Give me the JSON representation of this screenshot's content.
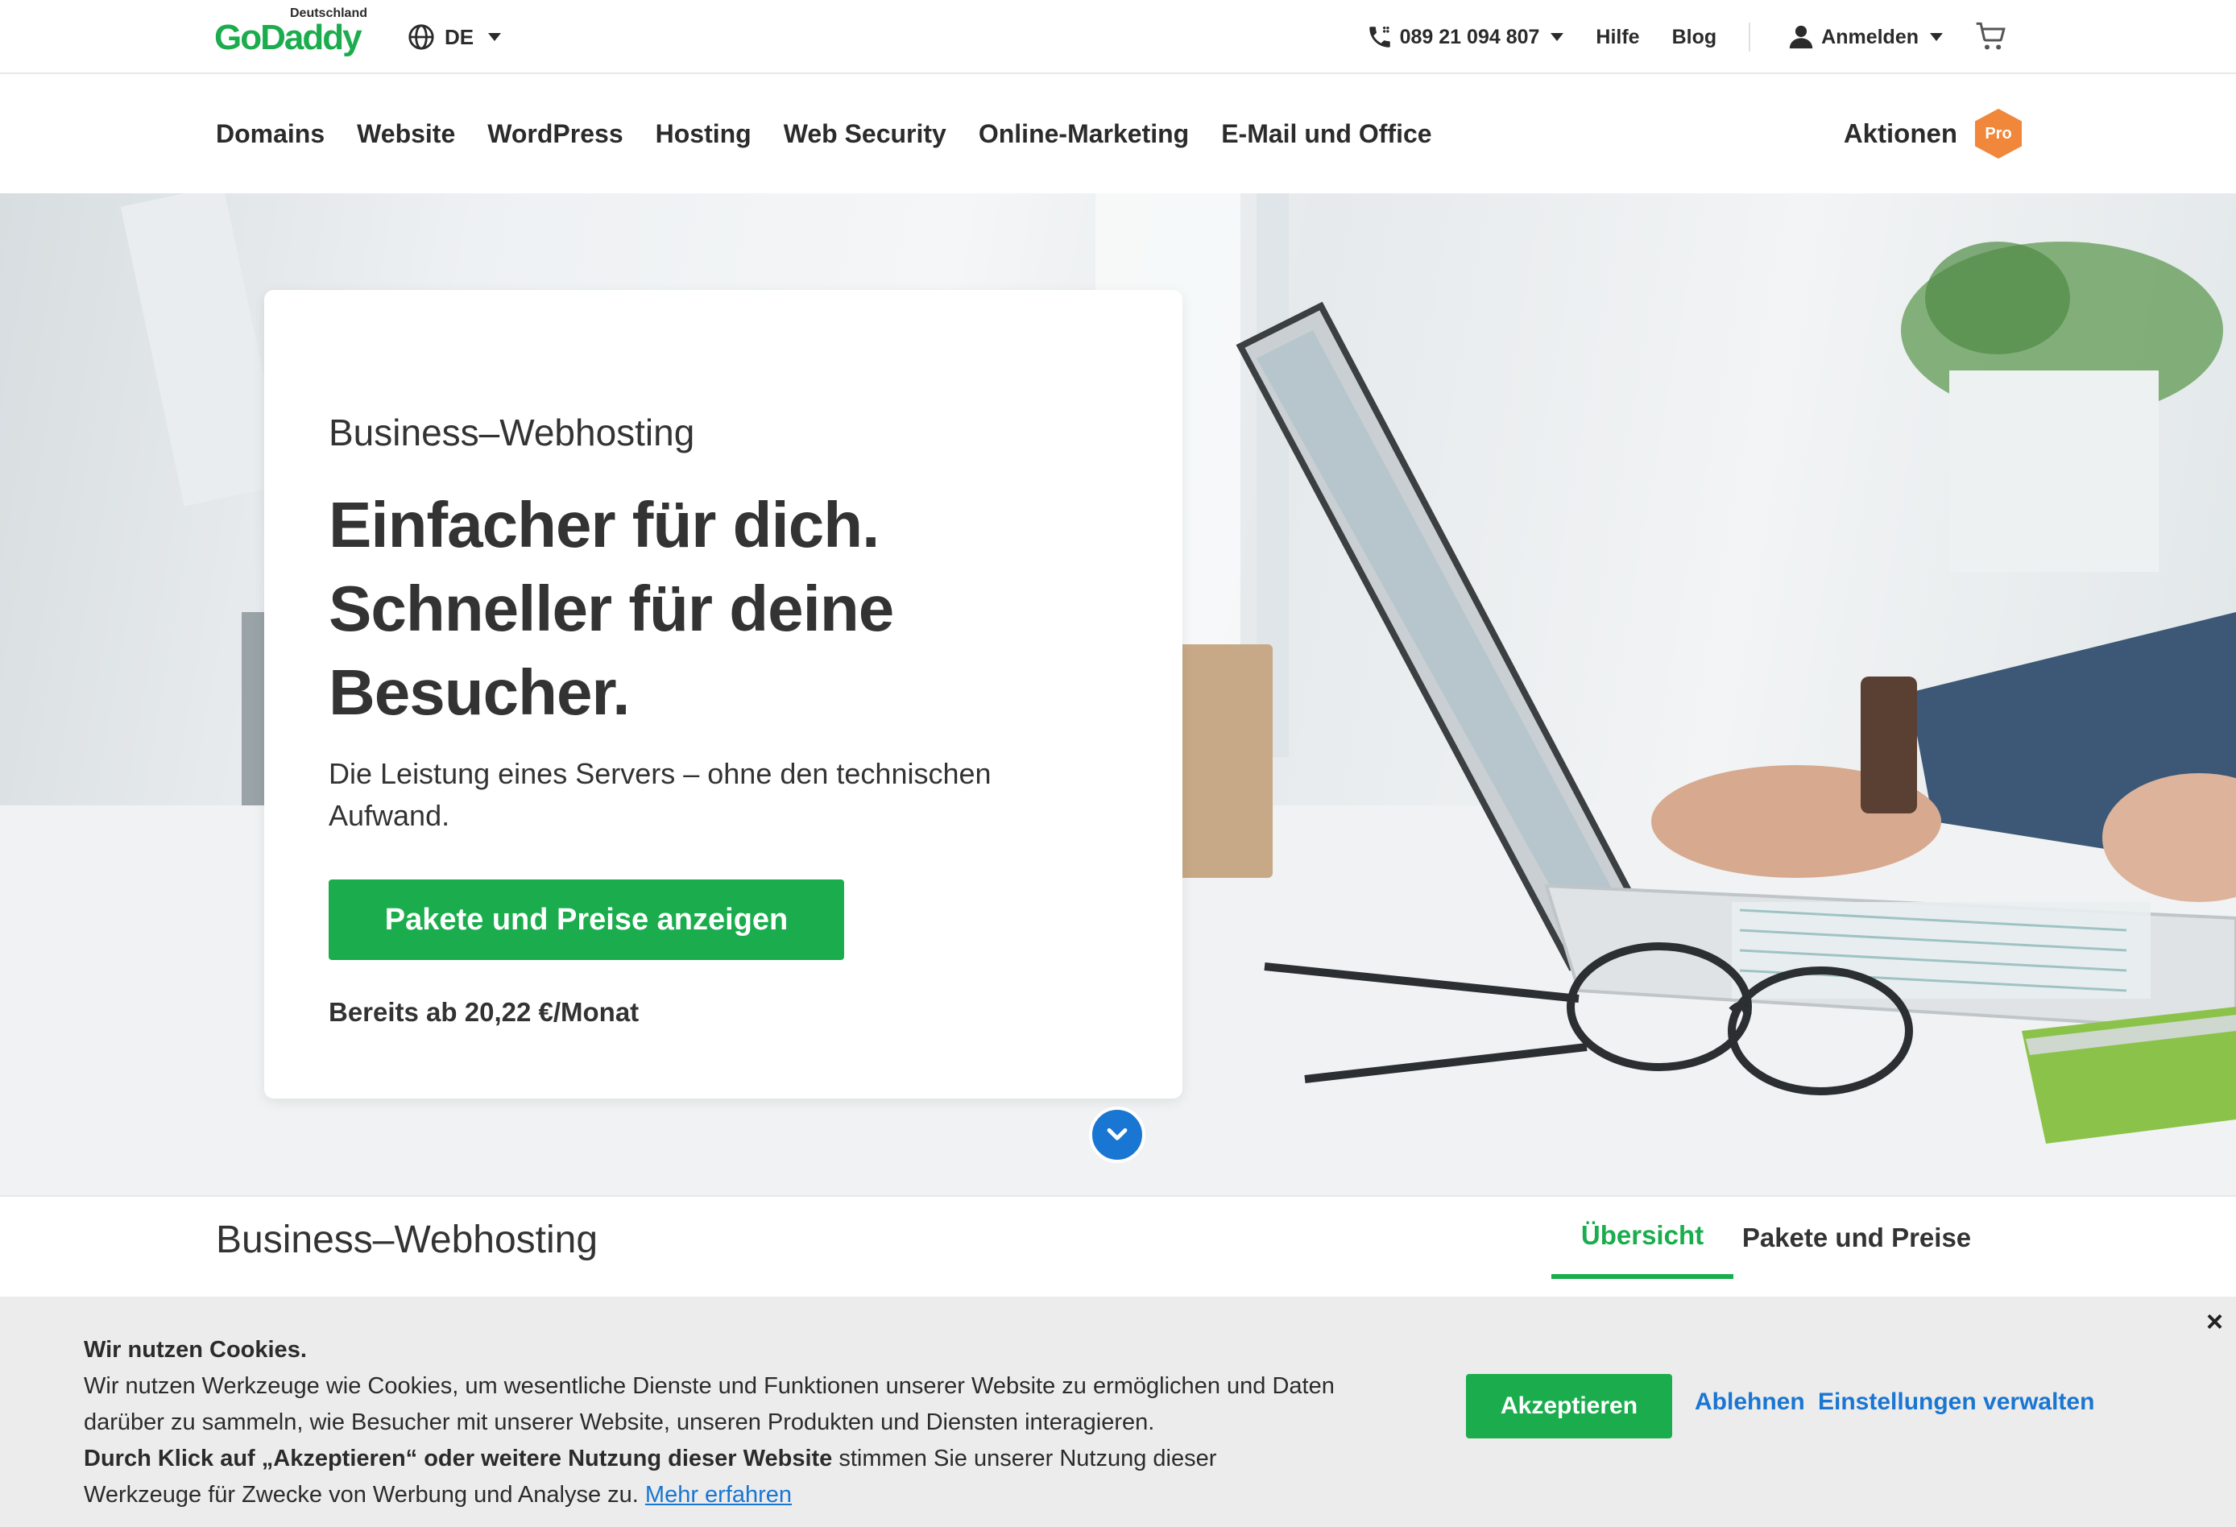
{
  "header": {
    "logo": {
      "brand": "GoDaddy",
      "country": "Deutschland"
    },
    "language": "DE",
    "phone": "089 21 094 807",
    "help": "Hilfe",
    "blog": "Blog",
    "signin": "Anmelden"
  },
  "nav": {
    "items": [
      "Domains",
      "Website",
      "WordPress",
      "Hosting",
      "Web Security",
      "Online-Marketing",
      "E-Mail und Office"
    ],
    "promotions": "Aktionen",
    "pro_badge": "Pro"
  },
  "hero": {
    "eyebrow": "Business–Webhosting",
    "headline_1": "Einfacher für dich.",
    "headline_2": "Schneller für deine",
    "headline_3": "Besucher.",
    "subtext": "Die Leistung eines Servers – ohne den technischen Aufwand.",
    "cta": "Pakete und Preise anzeigen",
    "price": "Bereits ab 20,22 €/Monat"
  },
  "subnav": {
    "title": "Business–Webhosting",
    "tabs": [
      {
        "label": "Übersicht",
        "active": true
      },
      {
        "label": "Pakete und Preise",
        "active": false
      }
    ]
  },
  "cookie": {
    "heading": "Wir nutzen Cookies.",
    "text_1": "Wir nutzen Werkzeuge wie Cookies, um wesentliche Dienste und Funktionen unserer Website zu ermöglichen und Daten darüber zu sammeln, wie Besucher mit unserer Website, unseren Produkten und Diensten interagieren.",
    "text_bold": "Durch Klick auf „Akzeptieren“ oder weitere Nutzung dieser Website",
    "text_2": " stimmen Sie unserer Nutzung dieser Werkzeuge für Zwecke von Werbung und Analyse zu. ",
    "learn_more": "Mehr erfahren",
    "accept": "Akzeptieren",
    "decline": "Ablehnen",
    "settings": "Einstellungen verwalten",
    "close": "×"
  },
  "colors": {
    "brand_green": "#1bad4d",
    "link_blue": "#1976d2",
    "pro_orange": "#f0873a",
    "text_dark": "#2b2b2b"
  },
  "icons": [
    "globe-icon",
    "phone-icon",
    "user-icon",
    "cart-icon",
    "chevron-down-icon",
    "close-icon"
  ]
}
